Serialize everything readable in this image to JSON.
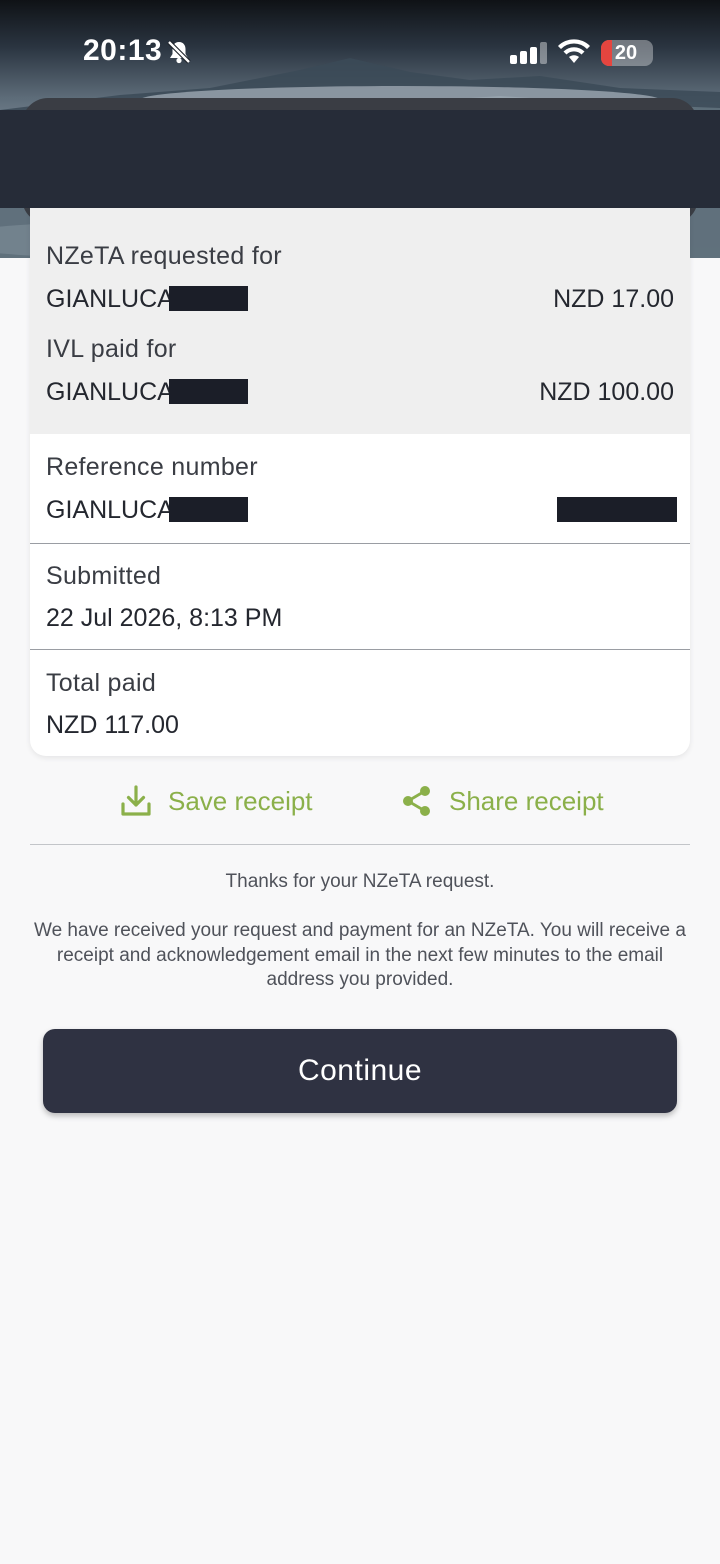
{
  "status_bar": {
    "time": "20:13",
    "battery_level": "20",
    "icons": [
      "bell-slash-icon",
      "cellular-signal-icon",
      "wifi-icon",
      "battery-icon"
    ]
  },
  "card": {
    "nzeta_label": "NZeTA requested for",
    "nzeta_name": "GIANLUCA",
    "nzeta_amount": "NZD 17.00",
    "ivl_label": "IVL paid for",
    "ivl_name": "GIANLUCA",
    "ivl_amount": "NZD 100.00",
    "reference_label": "Reference number",
    "reference_name": "GIANLUCA",
    "submitted_label": "Submitted",
    "submitted_value": "22 Jul 2026, 8:13 PM",
    "total_label": "Total paid",
    "total_value": "NZD 117.00"
  },
  "actions": {
    "save_label": "Save receipt",
    "share_label": "Share receipt",
    "accent_color": "#8bb04a"
  },
  "message": {
    "thanks": "Thanks for your NZeTA request.",
    "body": "We have received your request and payment for an NZeTA. You will receive a receipt and acknowledgement email in the next few minutes to the email address you provided."
  },
  "continue_button": {
    "label": "Continue",
    "color": "#2f3242"
  }
}
